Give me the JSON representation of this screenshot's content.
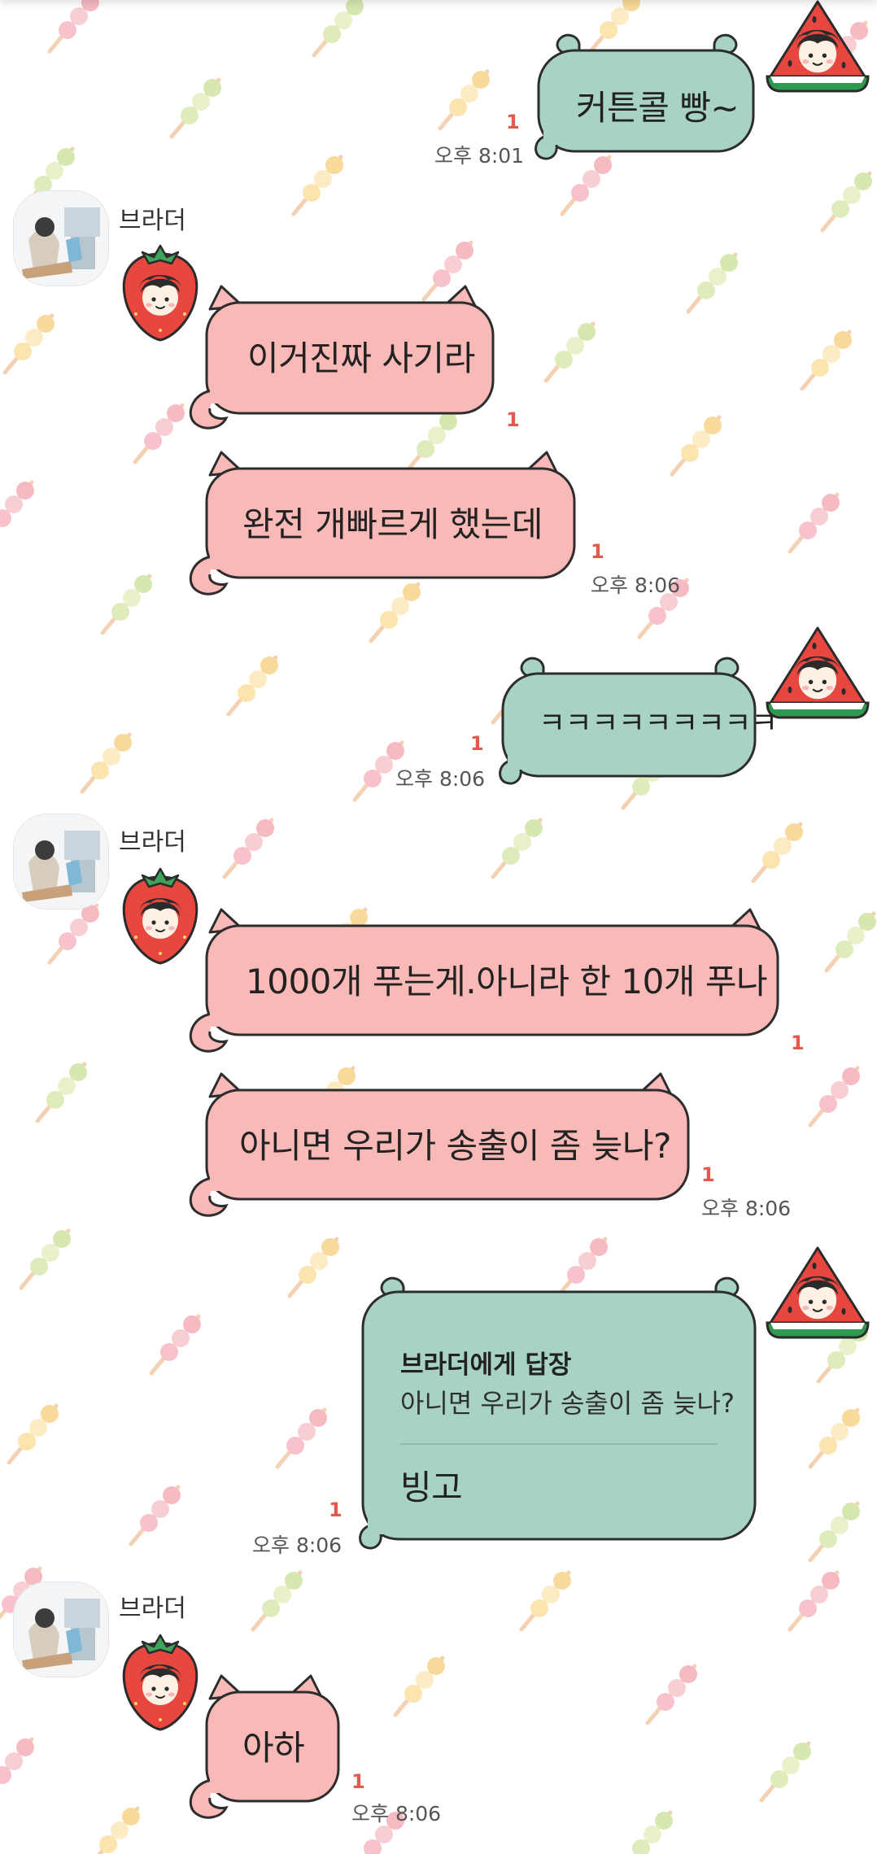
{
  "colors": {
    "sent_bubble": "#a8d3c4",
    "received_bubble": "#f8b9b7",
    "bubble_outline": "#2d2d2d",
    "unread": "#e05a4e",
    "time": "#555555"
  },
  "icons": {
    "watermelon": "watermelon-face-sticker",
    "strawberry": "strawberry-face-sticker",
    "dango": "dango-skewer-pattern"
  },
  "messages": [
    {
      "id": "m1",
      "side": "sent",
      "text": "커튼콜 빵~",
      "unread": "1",
      "time": "오후 8:01"
    },
    {
      "id": "m2",
      "side": "received",
      "sender": "브라더",
      "text": "이거진짜 사기라",
      "unread": "1"
    },
    {
      "id": "m3",
      "side": "received",
      "text": "완전 개빠르게 했는데",
      "unread": "1",
      "time": "오후 8:06"
    },
    {
      "id": "m4",
      "side": "sent",
      "text": "ㅋㅋㅋㅋㅋㅋㅋㅋㅋ",
      "unread": "1",
      "time": "오후 8:06"
    },
    {
      "id": "m5",
      "side": "received",
      "sender": "브라더",
      "text": "1000개 푸는게.아니라 한 10개 푸나",
      "unread": "1"
    },
    {
      "id": "m6",
      "side": "received",
      "text": "아니면 우리가 송출이 좀 늦나?",
      "unread": "1",
      "time": "오후 8:06"
    },
    {
      "id": "m7",
      "side": "sent",
      "reply_to": "브라더에게 답장",
      "quote": "아니면 우리가 송출이 좀 늦나?",
      "text": "빙고",
      "unread": "1",
      "time": "오후 8:06"
    },
    {
      "id": "m8",
      "side": "received",
      "sender": "브라더",
      "text": "아하",
      "unread": "1",
      "time": "오후 8:06"
    }
  ]
}
